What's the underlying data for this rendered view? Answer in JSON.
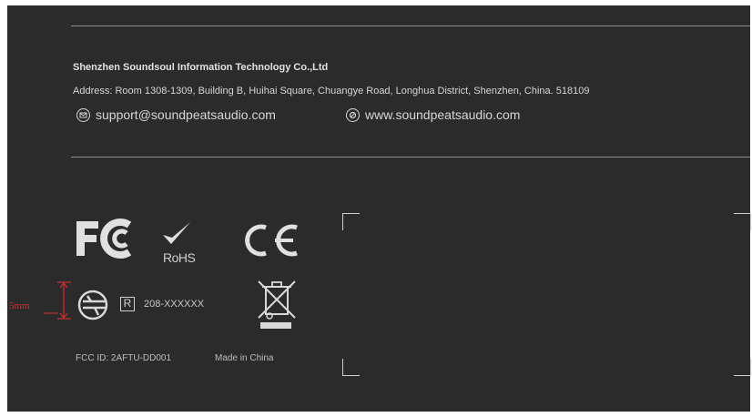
{
  "company": {
    "name": "Shenzhen Soundsoul Information Technology Co.,Ltd",
    "address": "Address: Room 1308-1309, Building B, Huihai Square, Chuangye Road, Longhua District, Shenzhen, China. 518109",
    "email": "support@soundpeatsaudio.com",
    "website": "www.soundpeatsaudio.com"
  },
  "marks": {
    "rohs": "RoHS",
    "registration_symbol": "R",
    "registration_number": "208-XXXXXX",
    "dimension_label": "5mm",
    "fcc_id": "FCC ID: 2AFTU-DD001",
    "made_in": "Made in China"
  },
  "icons": [
    "email-icon",
    "web-icon",
    "fcc-logo-icon",
    "rohs-check-icon",
    "ce-mark-icon",
    "telec-mark-icon",
    "weee-bin-icon"
  ],
  "colors": {
    "background": "#2b2b2b",
    "text": "#d6d6d6",
    "dimension": "#cc3030"
  }
}
